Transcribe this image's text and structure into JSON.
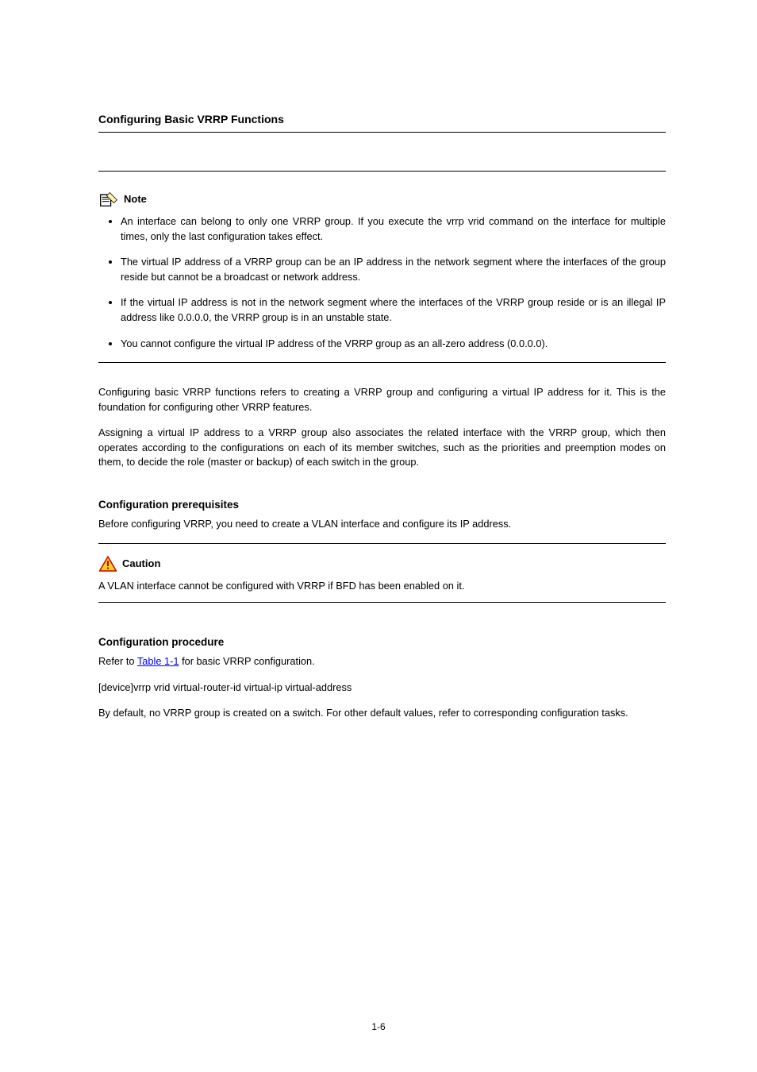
{
  "section": {
    "heading": "Configuring Basic VRRP Functions",
    "paragraphs": [
      "Configuring basic VRRP functions refers to creating a VRRP group and configuring a virtual IP address for it. This is the foundation for configuring other VRRP features.",
      "Assigning a virtual IP address to a VRRP group also associates the related interface with the VRRP group, which then operates according to the configurations on each of its member switches, such as the priorities and preemption modes on them, to decide the role (master or backup) of each switch in the group."
    ]
  },
  "note": {
    "label": "Note",
    "items": [
      "An interface can belong to only one VRRP group. If you execute the vrrp vrid command on the interface for multiple times, only the last configuration takes effect.",
      "The virtual IP address of a VRRP group can be an IP address in the network segment where the interfaces of the group reside but cannot be a broadcast or network address.",
      "If the virtual IP address is not in the network segment where the interfaces of the VRRP group reside or is an illegal IP address like 0.0.0.0, the VRRP group is in an unstable state.",
      "You cannot configure the virtual IP address of the VRRP group as an all-zero address (0.0.0.0)."
    ]
  },
  "caution": {
    "heading": "Configuration prerequisites",
    "intro": "Before configuring VRRP, you need to create a VLAN interface and configure its IP address.",
    "label": "Caution",
    "body": "A VLAN interface cannot be configured with VRRP if BFD has been enabled on it."
  },
  "procedure": {
    "heading": "Configuration procedure",
    "table_ref_prefix": "Refer to ",
    "table_ref_link": "Table 1-1",
    "table_ref_suffix": " for basic VRRP configuration.",
    "cmdline": "[device]vrrp vrid virtual-router-id virtual-ip virtual-address",
    "explain": "By default, no VRRP group is created on a switch. For other default values, refer to corresponding configuration tasks."
  },
  "page_number": "1-6"
}
